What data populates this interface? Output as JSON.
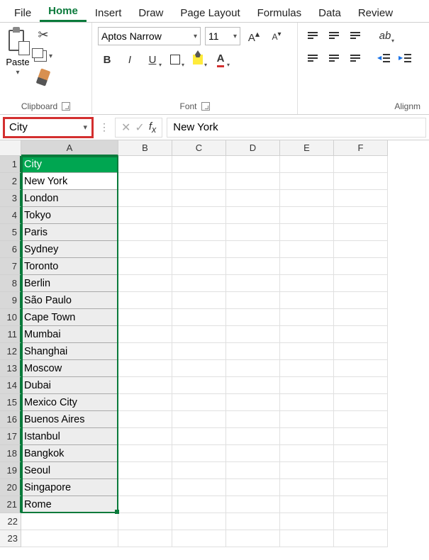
{
  "tabs": [
    "File",
    "Home",
    "Insert",
    "Draw",
    "Page Layout",
    "Formulas",
    "Data",
    "Review"
  ],
  "active_tab": "Home",
  "ribbon": {
    "clipboard": {
      "paste": "Paste",
      "label": "Clipboard"
    },
    "font": {
      "name": "Aptos Narrow",
      "size": "11",
      "label": "Font"
    },
    "alignment": {
      "label": "Alignm"
    }
  },
  "namebox": "City",
  "formula": "New York",
  "columns": [
    "A",
    "B",
    "C",
    "D",
    "E",
    "F"
  ],
  "cells_colA": [
    "City",
    "New York",
    "London",
    "Tokyo",
    "Paris",
    "Sydney",
    "Toronto",
    "Berlin",
    "São Paulo",
    "Cape Town",
    "Mumbai",
    "Shanghai",
    "Moscow",
    "Dubai",
    "Mexico City",
    "Buenos Aires",
    "Istanbul",
    "Bangkok",
    "Seoul",
    "Singapore",
    "Rome"
  ],
  "total_rows": 23,
  "selected_rows": 21,
  "active_row": 2
}
